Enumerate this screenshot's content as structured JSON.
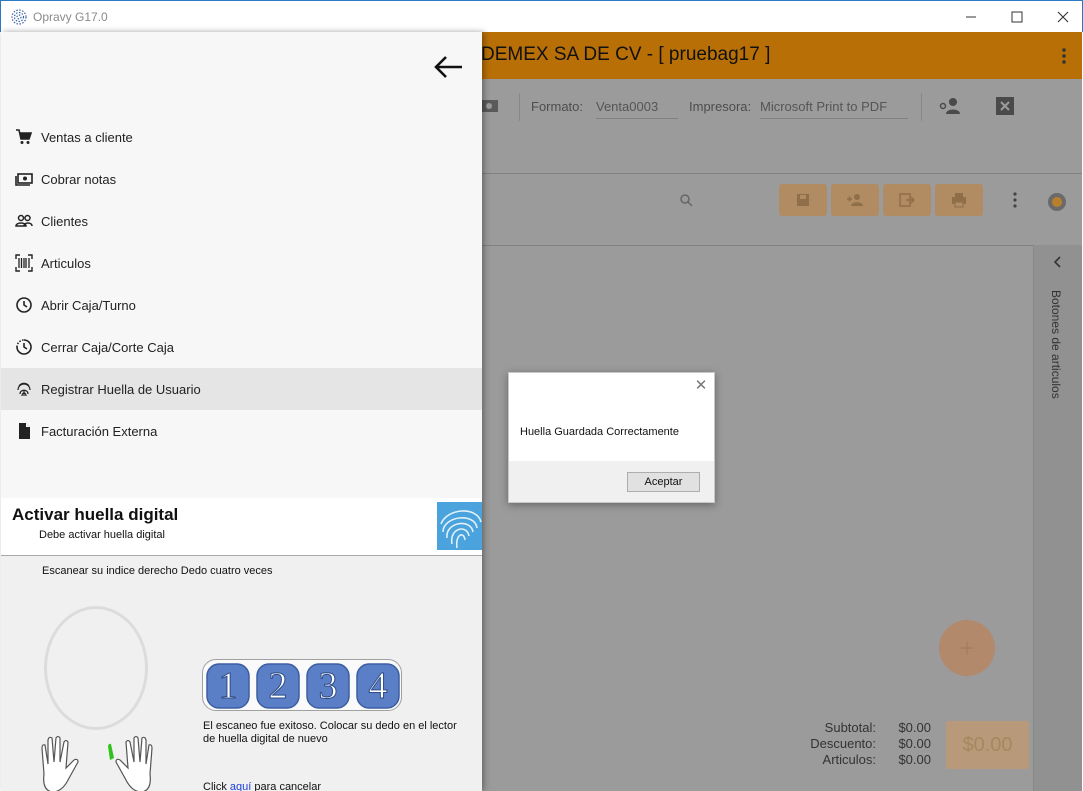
{
  "window": {
    "title": "Opravy G17.0",
    "minimize_label": "—",
    "maximize_label": "☐",
    "close_label": "✕"
  },
  "appbar": {
    "title": "DEMEX SA DE CV - [ pruebag17 ]",
    "menu_icon": "more-vert-icon",
    "color": "#b86f06"
  },
  "toolbar": {
    "formato_label": "Formato:",
    "formato_value": "Venta0003",
    "impresora_label": "Impresora:",
    "impresora_value": "Microsoft Print to PDF"
  },
  "side_panel": {
    "label": "Botones de articulos"
  },
  "totals": {
    "rows": [
      {
        "label": "Subtotal:",
        "value": "$0.00"
      },
      {
        "label": "Descuento:",
        "value": "$0.00"
      },
      {
        "label": "Articulos:",
        "value": "$0.00"
      }
    ],
    "total": "$0.00"
  },
  "fab": {
    "label": "+"
  },
  "drawer": {
    "menu": [
      {
        "label": "Ventas a cliente",
        "icon": "cart-icon"
      },
      {
        "label": "Cobrar notas",
        "icon": "cash-icon"
      },
      {
        "label": "Clientes",
        "icon": "people-icon"
      },
      {
        "label": "Articulos",
        "icon": "barcode-icon"
      },
      {
        "label": "Abrir Caja/Turno",
        "icon": "clock-icon"
      },
      {
        "label": "Cerrar Caja/Corte Caja",
        "icon": "clock-half-icon"
      },
      {
        "label": "Registrar Huella de Usuario",
        "icon": "fingerprint-icon",
        "active": true
      },
      {
        "label": "Facturación Externa",
        "icon": "document-icon"
      }
    ]
  },
  "fingerprint": {
    "title": "Activar huella digital",
    "subtitle": "Debe activar huella digital",
    "instruction": "Escanear su indice derecho Dedo cuatro veces",
    "steps": [
      "1",
      "2",
      "3",
      "4"
    ],
    "message": "El escaneo fue exitoso. Colocar su dedo en el lector de huella digital de nuevo",
    "cancel_prefix": "Click ",
    "cancel_link": "aquí",
    "cancel_suffix": " para cancelar"
  },
  "dialog": {
    "message": "Huella Guardada Correctamente",
    "button": "Aceptar",
    "close_label": "✕"
  }
}
